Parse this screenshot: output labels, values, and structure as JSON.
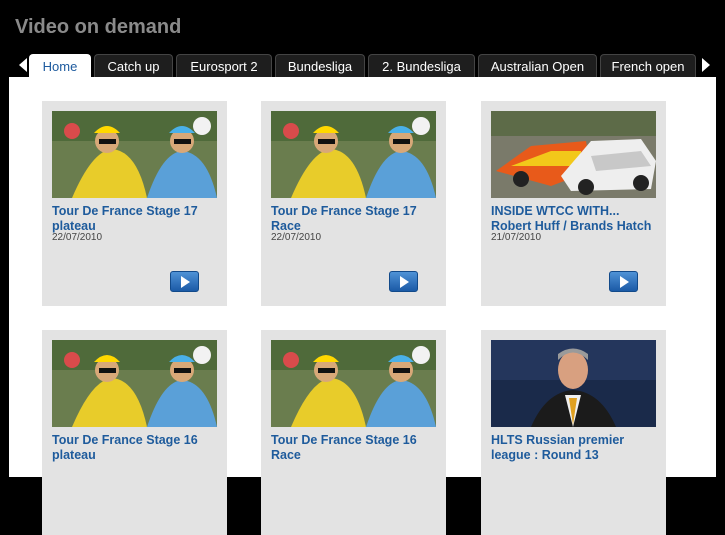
{
  "page": {
    "title": "Video on demand"
  },
  "tabs": [
    {
      "label": "Home",
      "active": true
    },
    {
      "label": "Catch up"
    },
    {
      "label": "Eurosport 2"
    },
    {
      "label": "Bundesliga"
    },
    {
      "label": "2. Bundesliga"
    },
    {
      "label": "Australian Open"
    },
    {
      "label": "French open"
    }
  ],
  "videos": [
    {
      "title": "Tour De France Stage 17 plateau",
      "date": "22/07/2010",
      "thumb": "cycling"
    },
    {
      "title": "Tour De France Stage 17 Race",
      "date": "22/07/2010",
      "thumb": "cycling"
    },
    {
      "title": "INSIDE WTCC WITH... Robert Huff / Brands Hatch",
      "date": "21/07/2010",
      "thumb": "touring-cars"
    },
    {
      "title": "Tour De France Stage 16 plateau",
      "date": "",
      "thumb": "cycling"
    },
    {
      "title": "Tour De France Stage 16 Race",
      "date": "",
      "thumb": "cycling"
    },
    {
      "title": "HLTS Russian premier league : Round 13",
      "date": "",
      "thumb": "football-coach"
    }
  ],
  "icons": {
    "prev": "left-arrow-icon",
    "next": "right-arrow-icon",
    "play": "play-icon"
  },
  "colors": {
    "accent": "#1e5b9c",
    "card_bg": "#e3e3e3",
    "header_bg": "#000000"
  }
}
